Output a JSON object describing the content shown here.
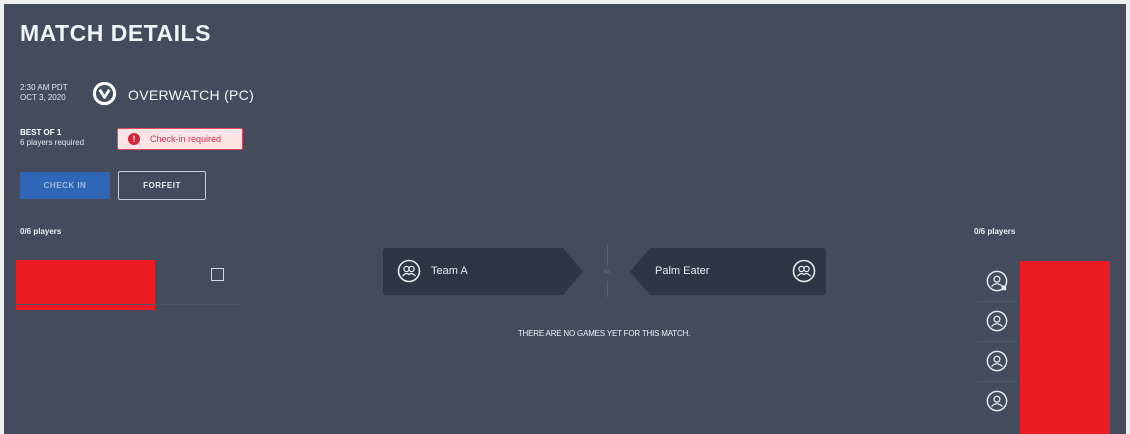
{
  "page": {
    "title": "MATCH DETAILS"
  },
  "match": {
    "time": "2:30 AM PDT",
    "date": "OCT 3, 2020",
    "game_icon": "overwatch-logo-icon",
    "game_name": "OVERWATCH (PC)",
    "format": "BEST OF 1",
    "players_required": "6 players required",
    "checkin_status": "Check-in required",
    "checkin_status_icon": "alert-icon",
    "checkin_status_color": "#d8213a"
  },
  "actions": {
    "check_in_label": "CHECK IN",
    "forfeit_label": "FORFEIT",
    "check_in_color": "#2f66b5"
  },
  "left_roster": {
    "count_label": "0/6 players"
  },
  "right_roster": {
    "count_label": "0/6 players",
    "avatar_icon": "user-avatar-icon"
  },
  "versus": {
    "team_a": {
      "name": "Team A",
      "icon": "team-icon"
    },
    "vs_label": "vs",
    "team_b": {
      "name": "Palm Eater",
      "icon": "team-icon"
    }
  },
  "games": {
    "empty_message": "THERE ARE NO GAMES YET FOR THIS MATCH."
  },
  "colors": {
    "background": "#444b5d",
    "panel": "#2f3544",
    "redaction": "#ec1b24"
  }
}
